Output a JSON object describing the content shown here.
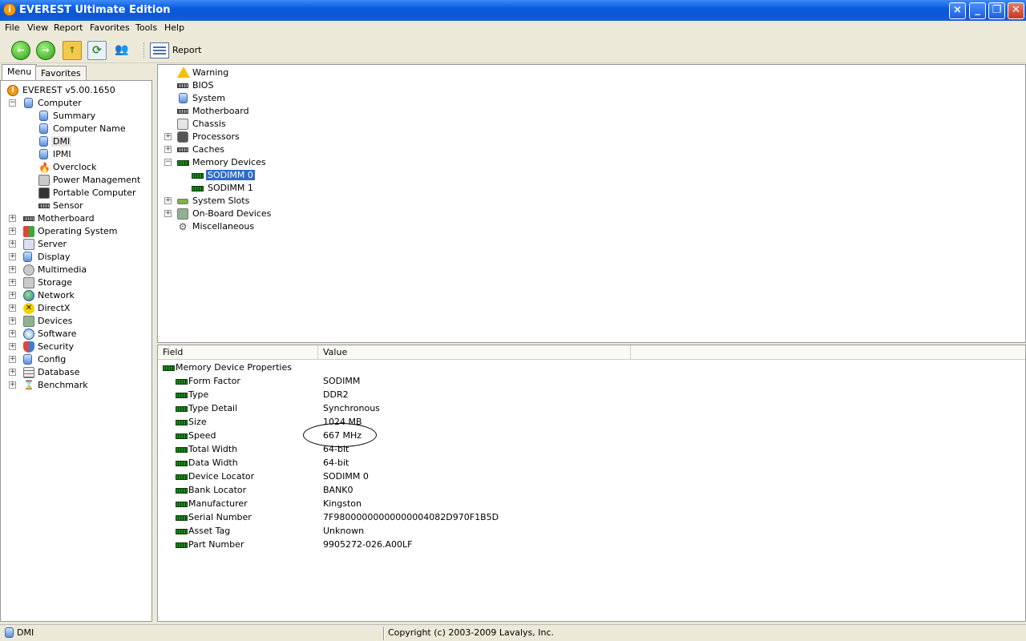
{
  "window": {
    "title": "EVEREST Ultimate Edition",
    "app_icon": "info-icon"
  },
  "menu": {
    "items": [
      "File",
      "View",
      "Report",
      "Favorites",
      "Tools",
      "Help"
    ]
  },
  "toolbar": {
    "report_label": "Report"
  },
  "left_tabs": [
    "Menu",
    "Favorites"
  ],
  "left_tree": {
    "root": "EVEREST v5.00.1650",
    "computer": "Computer",
    "computer_children": [
      "Summary",
      "Computer Name",
      "DMI",
      "IPMI",
      "Overclock",
      "Power Management",
      "Portable Computer",
      "Sensor"
    ],
    "categories": [
      "Motherboard",
      "Operating System",
      "Server",
      "Display",
      "Multimedia",
      "Storage",
      "Network",
      "DirectX",
      "Devices",
      "Software",
      "Security",
      "Config",
      "Database",
      "Benchmark"
    ]
  },
  "dmi_tree": {
    "items": [
      "Warning",
      "BIOS",
      "System",
      "Motherboard",
      "Chassis",
      "Processors",
      "Caches",
      "Memory Devices"
    ],
    "memory_children": [
      "SODIMM 0",
      "SODIMM 1"
    ],
    "after_items": [
      "System Slots",
      "On-Board Devices",
      "Miscellaneous"
    ]
  },
  "properties": {
    "columns": [
      "Field",
      "Value"
    ],
    "group": "Memory Device Properties",
    "rows": [
      {
        "field": "Form Factor",
        "value": "SODIMM"
      },
      {
        "field": "Type",
        "value": "DDR2"
      },
      {
        "field": "Type Detail",
        "value": "Synchronous"
      },
      {
        "field": "Size",
        "value": "1024 MB"
      },
      {
        "field": "Speed",
        "value": "667 MHz"
      },
      {
        "field": "Total Width",
        "value": "64-bit"
      },
      {
        "field": "Data Width",
        "value": "64-bit"
      },
      {
        "field": "Device Locator",
        "value": "SODIMM 0"
      },
      {
        "field": "Bank Locator",
        "value": "BANK0"
      },
      {
        "field": "Manufacturer",
        "value": "Kingston"
      },
      {
        "field": "Serial Number",
        "value": "7F98000000000000004082D970F1B5D"
      },
      {
        "field": "Asset Tag",
        "value": "Unknown"
      },
      {
        "field": "Part Number",
        "value": "9905272-026.A00LF"
      }
    ]
  },
  "status": {
    "left": "DMI",
    "right": "Copyright (c) 2003-2009 Lavalys, Inc."
  }
}
